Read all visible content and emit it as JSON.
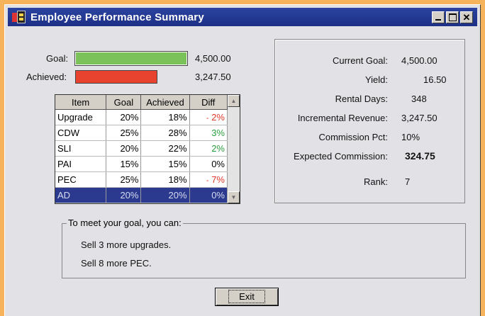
{
  "window": {
    "title": "Employee Performance Summary",
    "icon": "app-icon"
  },
  "colors": {
    "goal_bar": "#7cc25a",
    "achieved_bar": "#e8432e",
    "selected_row": "#2b3a8f"
  },
  "progress": {
    "goal_label": "Goal:",
    "goal_value": "4,500.00",
    "achieved_label": "Achieved:",
    "achieved_value": "3,247.50",
    "achieved_fraction": 0.72
  },
  "grid": {
    "headers": [
      "Item",
      "Goal",
      "Achieved",
      "Diff"
    ],
    "rows": [
      {
        "item": "Upgrade",
        "goal": "20%",
        "achieved": "18%",
        "diff": "2%",
        "marker": "-",
        "status": "neg"
      },
      {
        "item": "CDW",
        "goal": "25%",
        "achieved": "28%",
        "diff": "3%",
        "marker": "",
        "status": "pos"
      },
      {
        "item": "SLI",
        "goal": "20%",
        "achieved": "22%",
        "diff": "2%",
        "marker": "",
        "status": "pos"
      },
      {
        "item": "PAI",
        "goal": "15%",
        "achieved": "15%",
        "diff": "0%",
        "marker": "",
        "status": "zero"
      },
      {
        "item": "PEC",
        "goal": "25%",
        "achieved": "18%",
        "diff": "7%",
        "marker": "-",
        "status": "neg"
      },
      {
        "item": "AD",
        "goal": "20%",
        "achieved": "20%",
        "diff": "0%",
        "marker": "",
        "status": "zero",
        "selected": true
      }
    ]
  },
  "summary": {
    "current_goal_label": "Current Goal:",
    "current_goal_value": "4,500.00",
    "yield_label": "Yield:",
    "yield_value": "16.50",
    "rental_days_label": "Rental Days:",
    "rental_days_value": "348",
    "incremental_label": "Incremental Revenue:",
    "incremental_value": "3,247.50",
    "commission_pct_label": "Commission Pct:",
    "commission_pct_value": "10%",
    "expected_label": "Expected Commission:",
    "expected_value": "324.75",
    "rank_label": "Rank:",
    "rank_value": "7"
  },
  "tips": {
    "legend": "To meet your goal, you can:",
    "line1": "Sell 3 more upgrades.",
    "line2": "Sell 8 more PEC."
  },
  "exit_button": {
    "label": "Exit"
  }
}
